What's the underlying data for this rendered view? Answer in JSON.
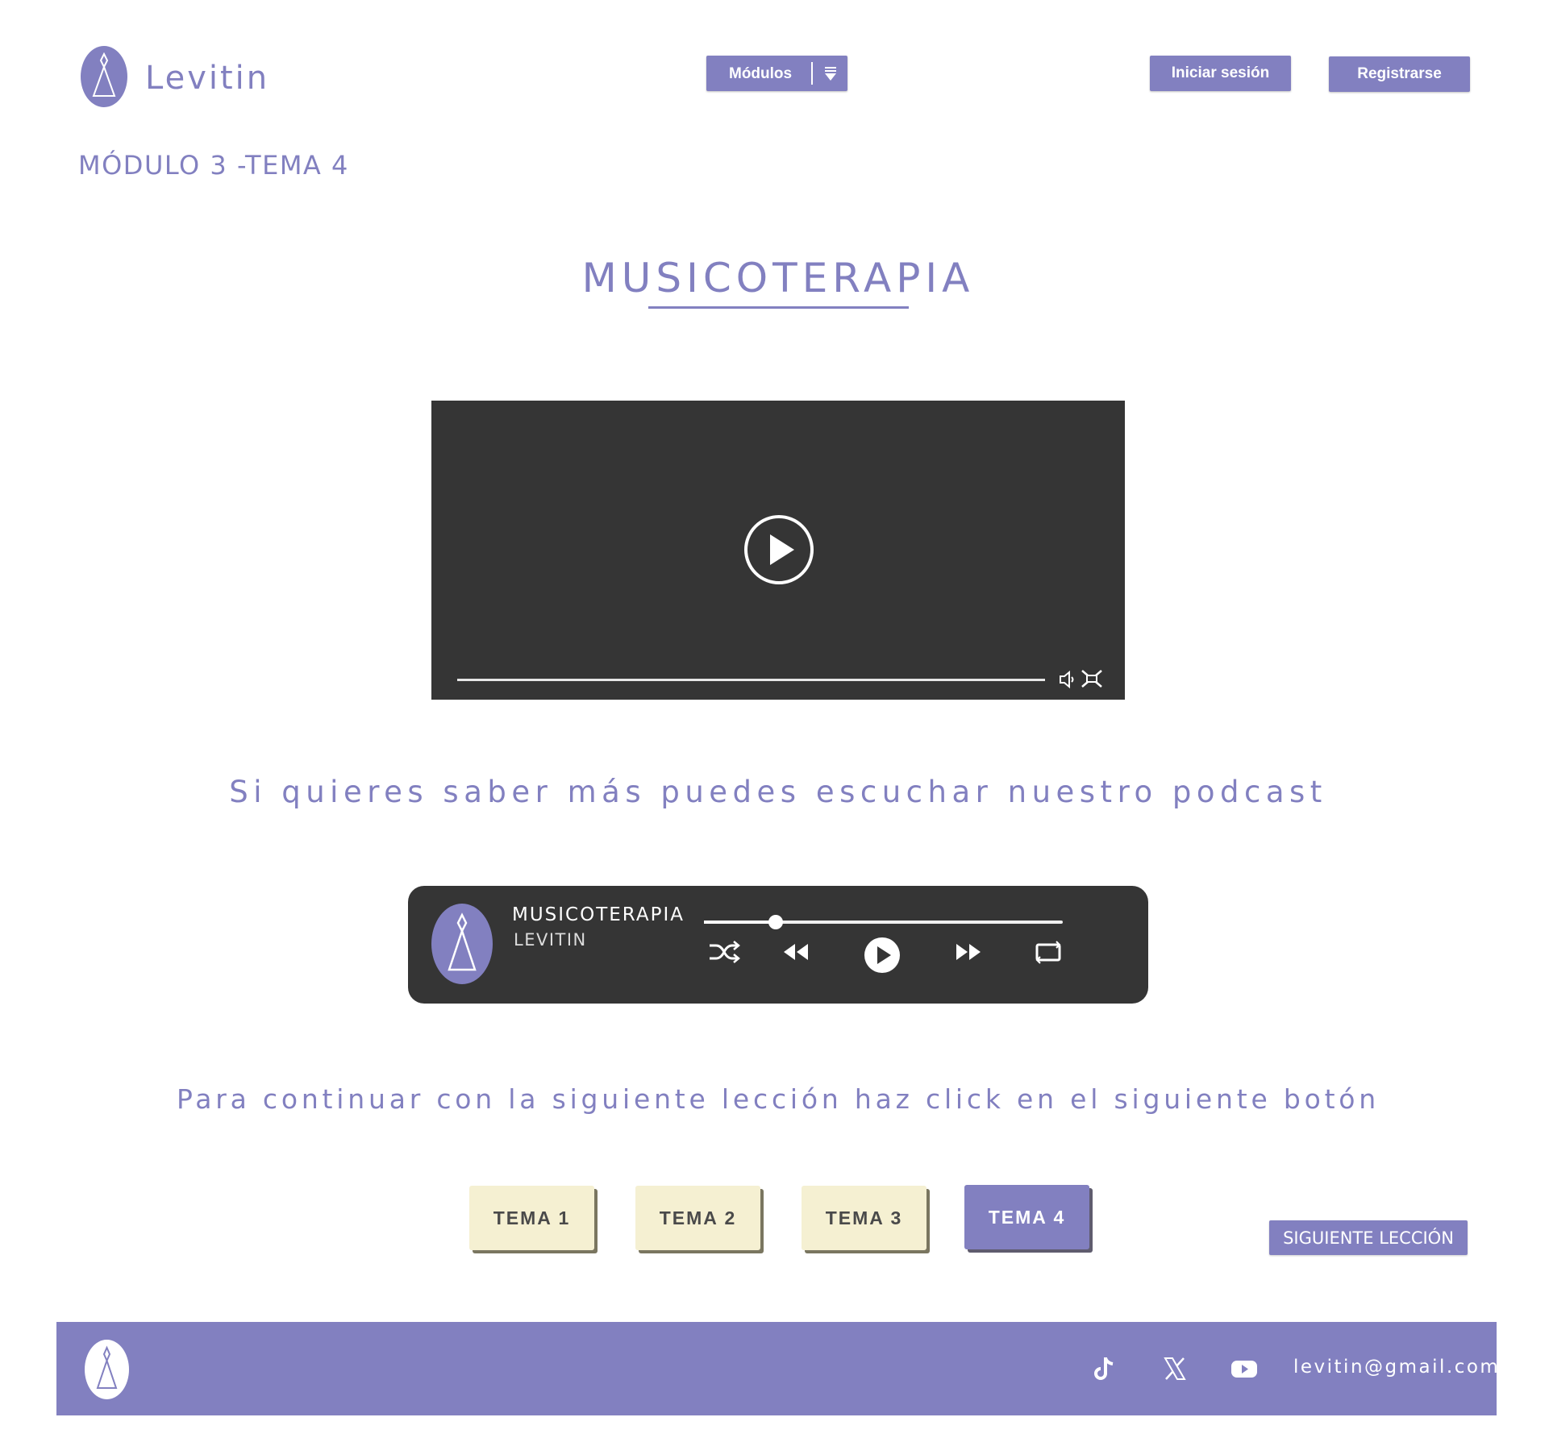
{
  "brand": {
    "name": "Levitin",
    "color": "#8280c0"
  },
  "header": {
    "modules_label": "Módulos",
    "login_label": "Iniciar sesión",
    "register_label": "Registrarse"
  },
  "breadcrumb": "MÓDULO 3 -TEMA 4",
  "main": {
    "title": "MUSICOTERAPIA",
    "video": {
      "progress": 0.0,
      "icons": [
        "play-icon",
        "volume-icon",
        "fullscreen-icon"
      ]
    },
    "podcast_intro": "Si quieres saber más puedes escuchar nuestro podcast",
    "player": {
      "title": "MUSICOTERAPIA",
      "artist": "LEVITIN",
      "progress": 0.2,
      "controls": [
        "shuffle-icon",
        "rewind-icon",
        "play-icon",
        "fast-forward-icon",
        "repeat-icon"
      ]
    },
    "continue_text": "Para continuar con la siguiente lección haz click en el siguiente botón",
    "topics": [
      {
        "label": "TEMA 1",
        "active": false
      },
      {
        "label": "TEMA 2",
        "active": false
      },
      {
        "label": "TEMA 3",
        "active": false
      },
      {
        "label": "TEMA 4",
        "active": true
      }
    ],
    "next_label": "SIGUIENTE LECCIÓN"
  },
  "footer": {
    "socials": [
      "tiktok-icon",
      "x-icon",
      "youtube-icon"
    ],
    "email": "levitin@gmail.com"
  }
}
